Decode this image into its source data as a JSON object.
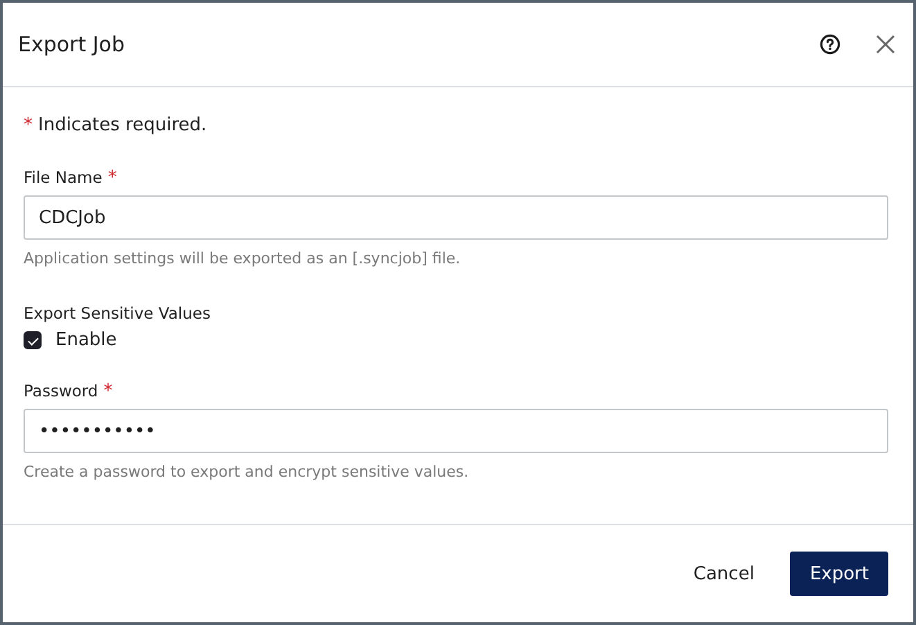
{
  "dialog": {
    "title": "Export Job"
  },
  "required_note": {
    "marker": "*",
    "text": "Indicates required."
  },
  "fields": [
    {
      "kind": "text",
      "label": "File Name",
      "required_marker": "*",
      "value": "CDCJob",
      "help": "Application settings will be exported as an [.syncjob] file."
    },
    {
      "kind": "checkbox",
      "label": "Export Sensitive Values",
      "option": "Enable",
      "checked": true
    },
    {
      "kind": "text",
      "label": "Password",
      "required_marker": "*",
      "value": "•••••••••••",
      "help": "Create a password to export and encrypt sensitive values."
    }
  ],
  "buttons": [
    {
      "label": "Cancel",
      "kind": "secondary"
    },
    {
      "label": "Export",
      "kind": "primary"
    }
  ]
}
